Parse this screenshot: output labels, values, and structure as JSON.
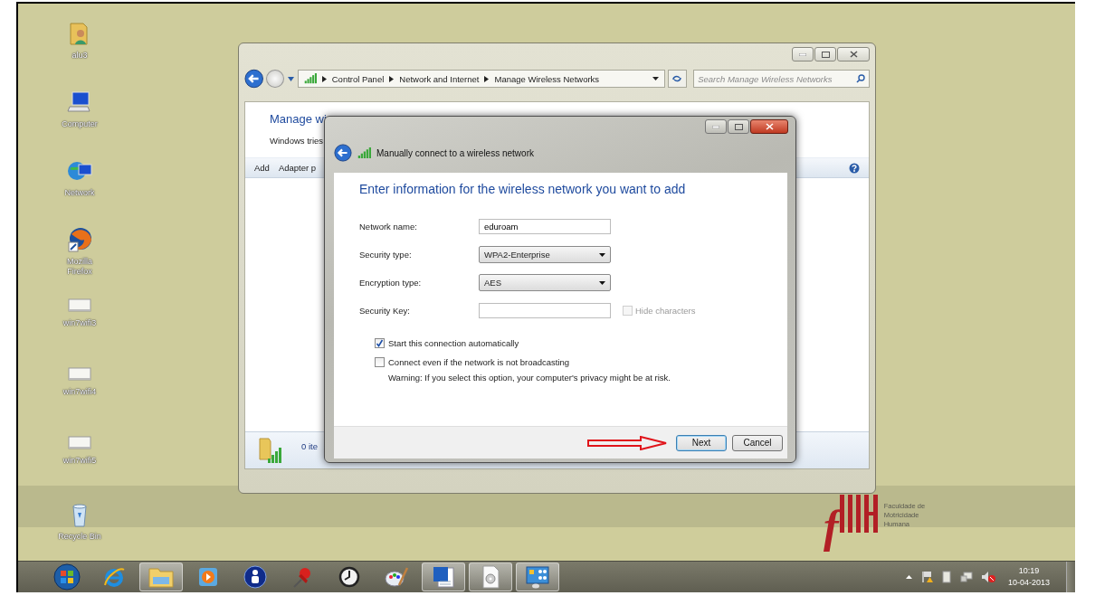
{
  "desktop_icons": [
    {
      "label": "alu3",
      "kind": "user-folder"
    },
    {
      "label": "Computer",
      "kind": "computer"
    },
    {
      "label": "Network",
      "kind": "network"
    },
    {
      "label": "Mozilla Firefox",
      "kind": "browser"
    },
    {
      "label": "win7wifi3",
      "kind": "file"
    },
    {
      "label": "win7wifi4",
      "kind": "file"
    },
    {
      "label": "win7wifi5",
      "kind": "file"
    },
    {
      "label": "Recycle Bin",
      "kind": "recycle-bin"
    }
  ],
  "explorer_window": {
    "breadcrumb": [
      "Control Panel",
      "Network and Internet",
      "Manage Wireless Networks"
    ],
    "search": {
      "placeholder": "Search Manage Wireless Networks"
    },
    "heading": "Manage wi",
    "description": "Windows tries",
    "toolbar": [
      "Add",
      "Adapter p"
    ],
    "status": "0 ite"
  },
  "dialog": {
    "title": "Manually connect to a wireless network",
    "heading": "Enter information for the wireless network you want to add",
    "fields": [
      {
        "label": "Network name:",
        "kind": "text",
        "value": "eduroam"
      },
      {
        "label": "Security type:",
        "kind": "select",
        "value": "WPA2-Enterprise"
      },
      {
        "label": "Encryption type:",
        "kind": "select",
        "value": "AES"
      },
      {
        "label": "Security Key:",
        "kind": "text",
        "hide_option": {
          "label": "Hide characters",
          "checked": false,
          "disabled": true
        }
      }
    ],
    "options": [
      {
        "label": "Start this connection automatically",
        "checked": true
      },
      {
        "label": "Connect even if the network is not broadcasting",
        "checked": false,
        "note": "Warning: If you select this option, your computer's privacy might be at risk."
      }
    ],
    "buttons": [
      {
        "label": "Next",
        "default": true
      },
      {
        "label": "Cancel",
        "default": false
      }
    ]
  },
  "logo": {
    "letter": "f",
    "lines": [
      "Faculdade de",
      "Motricidade",
      "Humana"
    ]
  },
  "taskbar": {
    "apps": [
      {
        "kind": "start",
        "active": false
      },
      {
        "kind": "ie",
        "active": false
      },
      {
        "kind": "explorer",
        "active": true
      },
      {
        "kind": "media",
        "active": false
      },
      {
        "kind": "person",
        "active": false
      },
      {
        "kind": "pin",
        "active": false
      },
      {
        "kind": "clock",
        "active": false
      },
      {
        "kind": "paint",
        "active": false
      },
      {
        "kind": "word",
        "active": true
      },
      {
        "kind": "disc",
        "active": true
      },
      {
        "kind": "control-panel",
        "active": true
      }
    ],
    "time": "10:19",
    "date": "10-04-2013"
  }
}
